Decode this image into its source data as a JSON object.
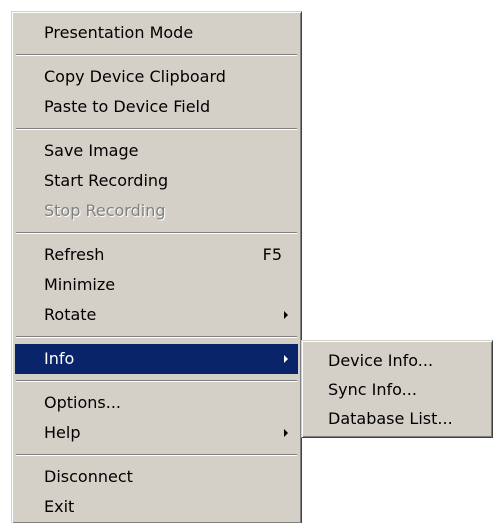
{
  "context_menu": {
    "groups": [
      {
        "items": [
          {
            "label": "Presentation Mode"
          }
        ]
      },
      {
        "items": [
          {
            "label": "Copy Device Clipboard"
          },
          {
            "label": "Paste to Device Field"
          }
        ]
      },
      {
        "items": [
          {
            "label": "Save Image"
          },
          {
            "label": "Start Recording"
          },
          {
            "label": "Stop Recording",
            "disabled": true
          }
        ]
      },
      {
        "items": [
          {
            "label": "Refresh",
            "shortcut": "F5"
          },
          {
            "label": "Minimize"
          },
          {
            "label": "Rotate",
            "has_submenu": true
          }
        ]
      },
      {
        "items": [
          {
            "label": "Info",
            "has_submenu": true,
            "highlighted": true
          }
        ]
      },
      {
        "items": [
          {
            "label": "Options..."
          },
          {
            "label": "Help",
            "has_submenu": true
          }
        ]
      },
      {
        "items": [
          {
            "label": "Disconnect"
          },
          {
            "label": "Exit"
          }
        ]
      }
    ]
  },
  "info_submenu": {
    "items": [
      {
        "label": "Device Info..."
      },
      {
        "label": "Sync Info..."
      },
      {
        "label": "Database List..."
      }
    ]
  },
  "colors": {
    "menu_face": "#d4d0c8",
    "highlight": "#0a246a",
    "highlight_text": "#ffffff",
    "disabled_text": "#808080"
  },
  "icons": {
    "submenu_arrow": "chevron-right-icon"
  }
}
